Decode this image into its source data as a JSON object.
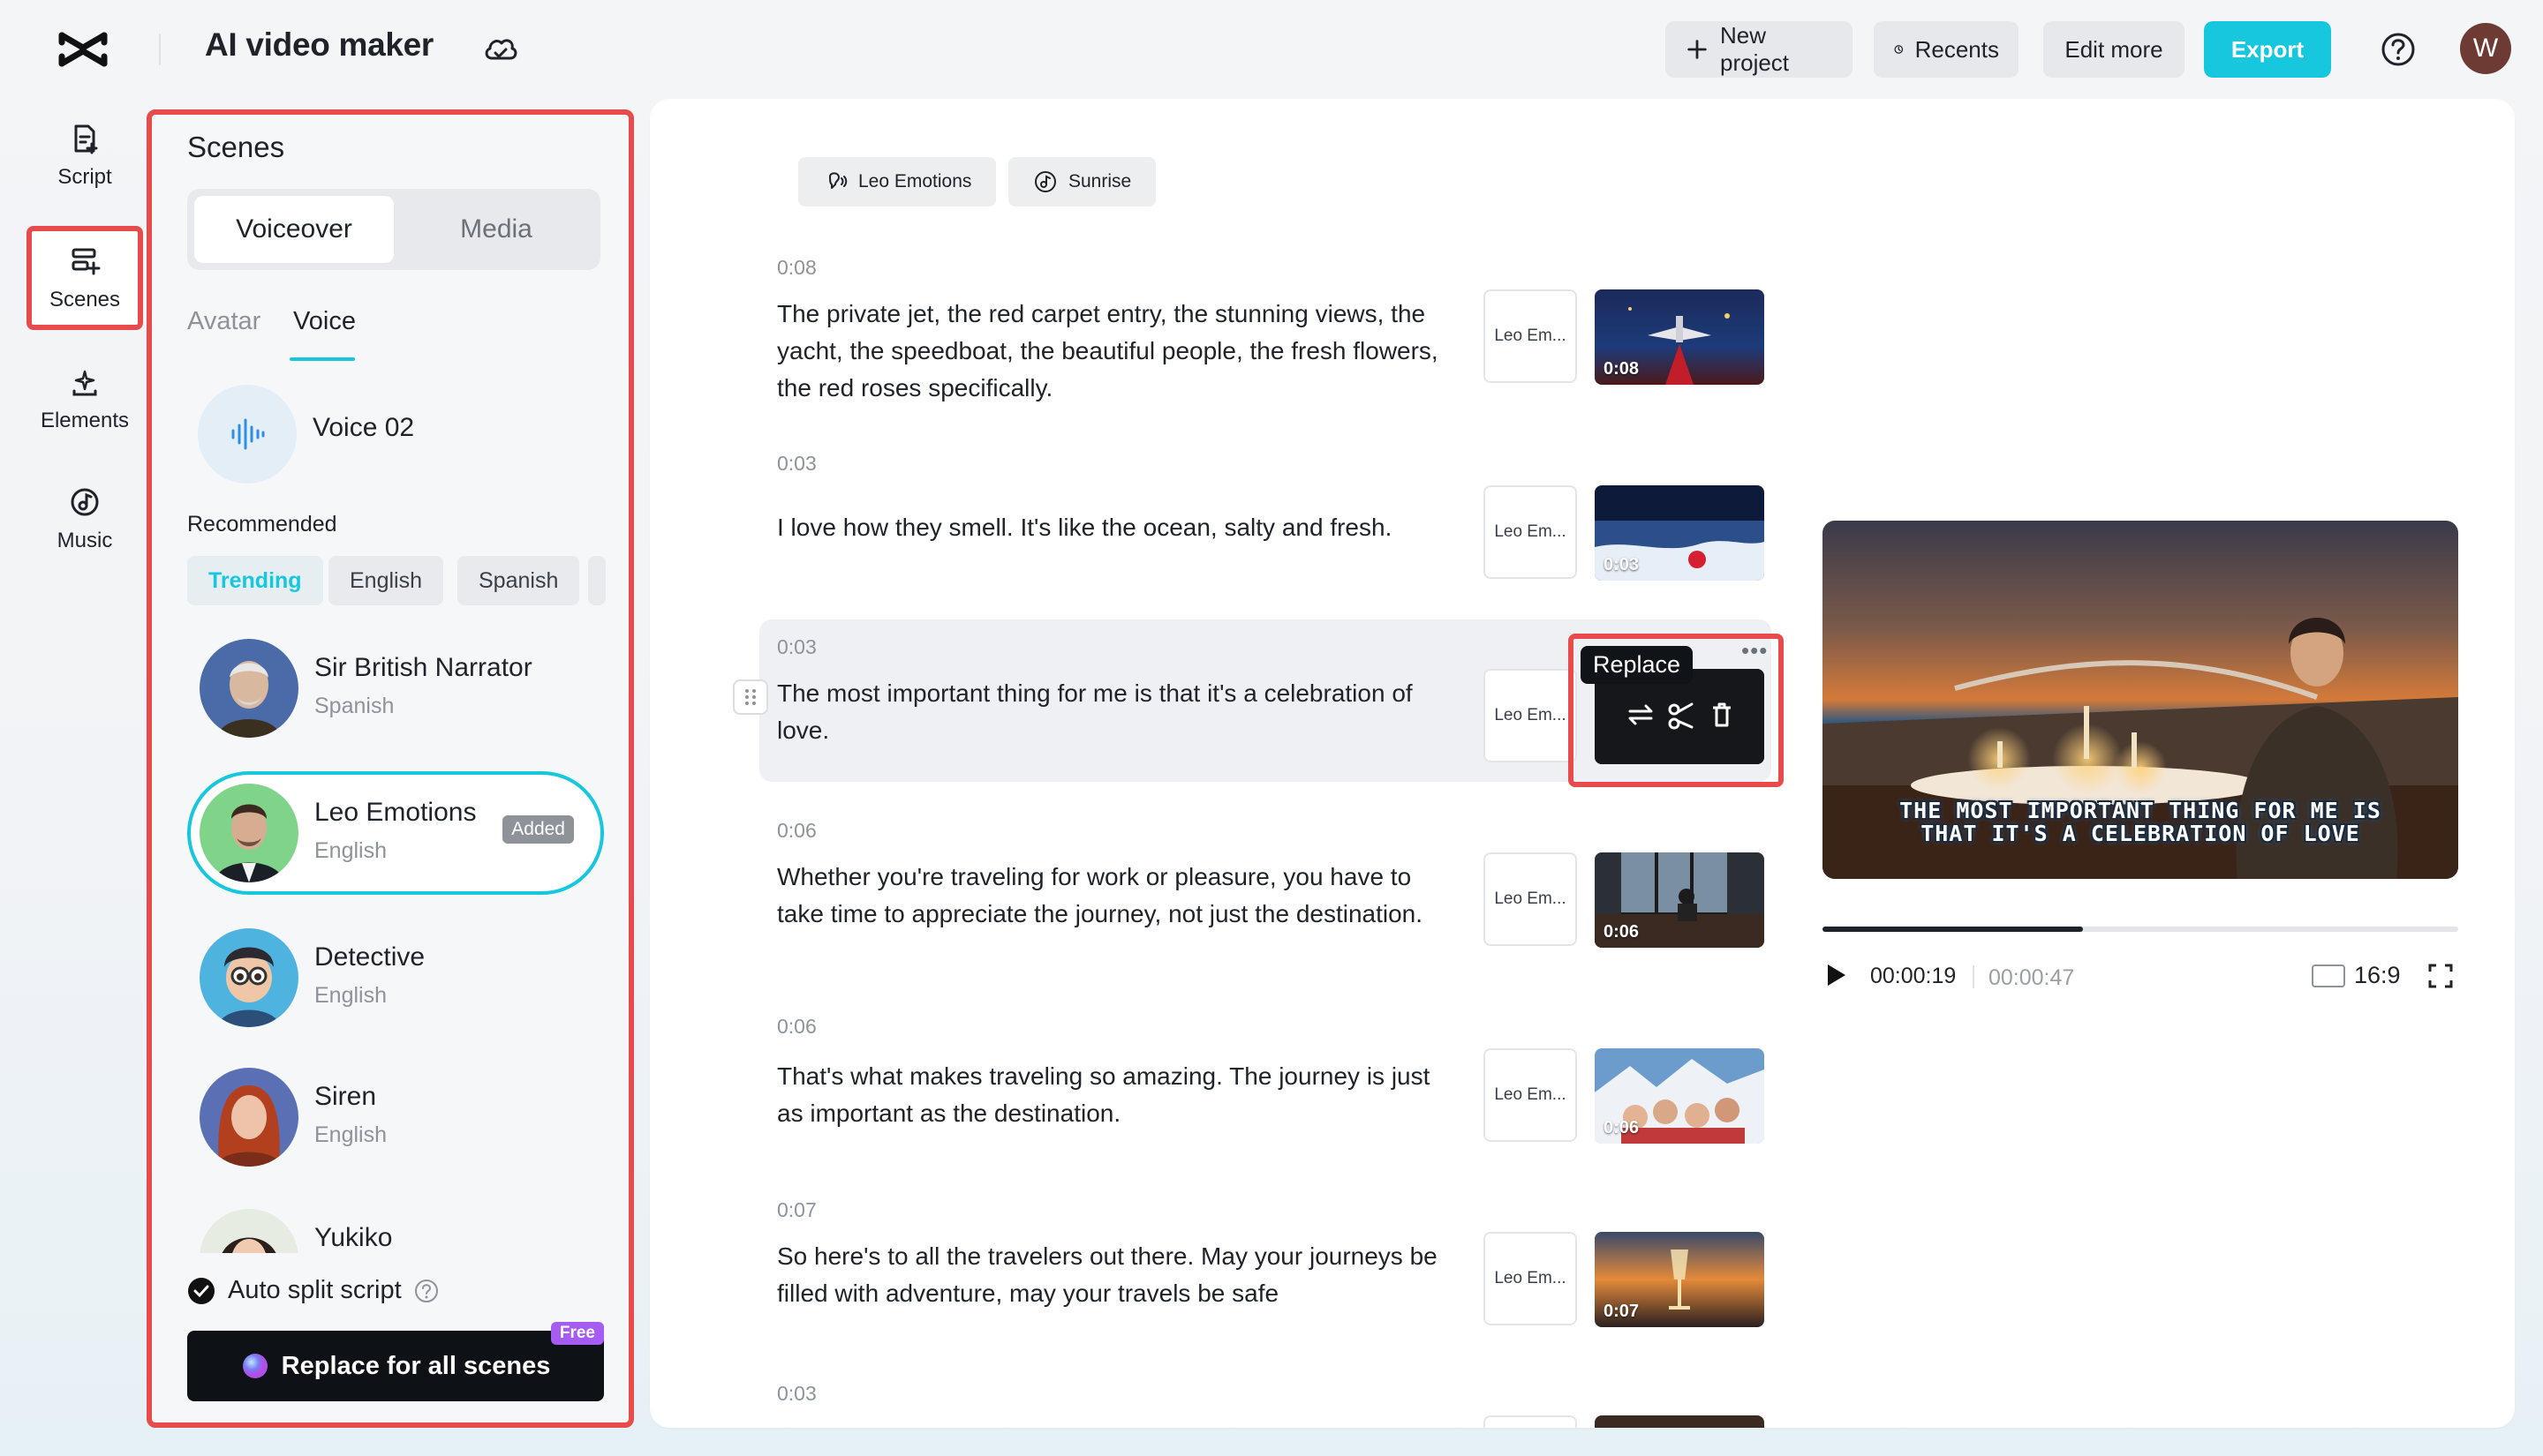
{
  "app": {
    "title": "AI video maker"
  },
  "topbar": {
    "new_project": "New project",
    "recents": "Recents",
    "edit_more": "Edit more",
    "export": "Export",
    "avatar_initial": "W",
    "accent": "#16c7dd"
  },
  "rail": {
    "items": [
      {
        "label": "Script"
      },
      {
        "label": "Scenes"
      },
      {
        "label": "Elements"
      },
      {
        "label": "Music"
      }
    ]
  },
  "scenes_panel": {
    "title": "Scenes",
    "tabs": [
      "Voiceover",
      "Media"
    ],
    "subtabs": [
      "Avatar",
      "Voice"
    ],
    "current_voice": "Voice 02",
    "recommended_label": "Recommended",
    "chips": [
      "Trending",
      "English",
      "Spanish"
    ],
    "voices": [
      {
        "name": "Sir British Narrator",
        "lang": "Spanish"
      },
      {
        "name": "Leo Emotions",
        "lang": "English",
        "badge": "Added"
      },
      {
        "name": "Detective",
        "lang": "English"
      },
      {
        "name": "Siren",
        "lang": "English"
      },
      {
        "name": "Yukiko",
        "lang": ""
      }
    ],
    "auto_split": "Auto split script",
    "replace_all": "Replace for all scenes",
    "free_badge": "Free"
  },
  "main": {
    "tags": [
      "Leo Emotions",
      "Sunrise"
    ],
    "voice_thumb_label": "Leo Em...",
    "scenes": [
      {
        "time": "0:08",
        "text": "The private jet, the red carpet entry, the stunning views, the yacht, the speedboat, the beautiful people, the fresh flowers, the red roses specifically.",
        "dur": "0:08"
      },
      {
        "time": "0:03",
        "text": "I love how they smell. It's like the ocean, salty and fresh.",
        "dur": "0:03"
      },
      {
        "time": "0:03",
        "text": "The most important thing for me is that it's a celebration of love.",
        "dur": ""
      },
      {
        "time": "0:06",
        "text": "Whether you're traveling for work or pleasure, you have to take time to appreciate the journey, not just the destination.",
        "dur": "0:06"
      },
      {
        "time": "0:06",
        "text": "That's what makes traveling so amazing. The journey is just as important as the destination.",
        "dur": "0:06"
      },
      {
        "time": "0:07",
        "text": "So here's to all the travelers out there. May your journeys be filled with adventure, may your travels be safe",
        "dur": "0:07"
      },
      {
        "time": "0:03",
        "text": "",
        "dur": ""
      }
    ],
    "replace_tooltip": "Replace"
  },
  "preview": {
    "caption_line1": "THE MOST IMPORTANT THING FOR ME IS",
    "caption_line2": "THAT IT'S A CELEBRATION OF LOVE",
    "current_time": "00:00:19",
    "total_time": "00:00:47",
    "progress": 0.41,
    "ratio": "16:9"
  }
}
